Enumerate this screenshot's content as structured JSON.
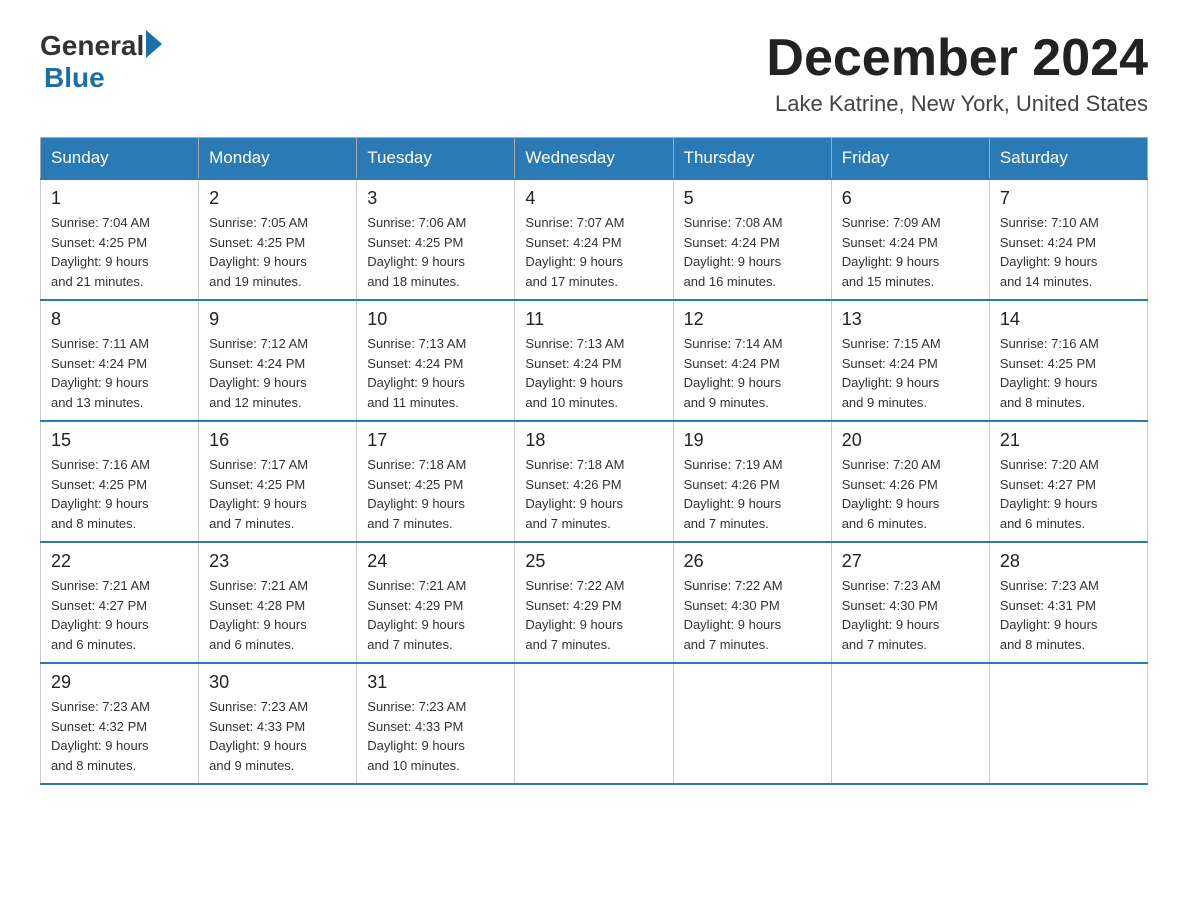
{
  "logo": {
    "general": "General",
    "blue": "Blue"
  },
  "title": "December 2024",
  "location": "Lake Katrine, New York, United States",
  "days_of_week": [
    "Sunday",
    "Monday",
    "Tuesday",
    "Wednesday",
    "Thursday",
    "Friday",
    "Saturday"
  ],
  "weeks": [
    [
      {
        "day": "1",
        "sunrise": "7:04 AM",
        "sunset": "4:25 PM",
        "daylight": "9 hours and 21 minutes."
      },
      {
        "day": "2",
        "sunrise": "7:05 AM",
        "sunset": "4:25 PM",
        "daylight": "9 hours and 19 minutes."
      },
      {
        "day": "3",
        "sunrise": "7:06 AM",
        "sunset": "4:25 PM",
        "daylight": "9 hours and 18 minutes."
      },
      {
        "day": "4",
        "sunrise": "7:07 AM",
        "sunset": "4:24 PM",
        "daylight": "9 hours and 17 minutes."
      },
      {
        "day": "5",
        "sunrise": "7:08 AM",
        "sunset": "4:24 PM",
        "daylight": "9 hours and 16 minutes."
      },
      {
        "day": "6",
        "sunrise": "7:09 AM",
        "sunset": "4:24 PM",
        "daylight": "9 hours and 15 minutes."
      },
      {
        "day": "7",
        "sunrise": "7:10 AM",
        "sunset": "4:24 PM",
        "daylight": "9 hours and 14 minutes."
      }
    ],
    [
      {
        "day": "8",
        "sunrise": "7:11 AM",
        "sunset": "4:24 PM",
        "daylight": "9 hours and 13 minutes."
      },
      {
        "day": "9",
        "sunrise": "7:12 AM",
        "sunset": "4:24 PM",
        "daylight": "9 hours and 12 minutes."
      },
      {
        "day": "10",
        "sunrise": "7:13 AM",
        "sunset": "4:24 PM",
        "daylight": "9 hours and 11 minutes."
      },
      {
        "day": "11",
        "sunrise": "7:13 AM",
        "sunset": "4:24 PM",
        "daylight": "9 hours and 10 minutes."
      },
      {
        "day": "12",
        "sunrise": "7:14 AM",
        "sunset": "4:24 PM",
        "daylight": "9 hours and 9 minutes."
      },
      {
        "day": "13",
        "sunrise": "7:15 AM",
        "sunset": "4:24 PM",
        "daylight": "9 hours and 9 minutes."
      },
      {
        "day": "14",
        "sunrise": "7:16 AM",
        "sunset": "4:25 PM",
        "daylight": "9 hours and 8 minutes."
      }
    ],
    [
      {
        "day": "15",
        "sunrise": "7:16 AM",
        "sunset": "4:25 PM",
        "daylight": "9 hours and 8 minutes."
      },
      {
        "day": "16",
        "sunrise": "7:17 AM",
        "sunset": "4:25 PM",
        "daylight": "9 hours and 7 minutes."
      },
      {
        "day": "17",
        "sunrise": "7:18 AM",
        "sunset": "4:25 PM",
        "daylight": "9 hours and 7 minutes."
      },
      {
        "day": "18",
        "sunrise": "7:18 AM",
        "sunset": "4:26 PM",
        "daylight": "9 hours and 7 minutes."
      },
      {
        "day": "19",
        "sunrise": "7:19 AM",
        "sunset": "4:26 PM",
        "daylight": "9 hours and 7 minutes."
      },
      {
        "day": "20",
        "sunrise": "7:20 AM",
        "sunset": "4:26 PM",
        "daylight": "9 hours and 6 minutes."
      },
      {
        "day": "21",
        "sunrise": "7:20 AM",
        "sunset": "4:27 PM",
        "daylight": "9 hours and 6 minutes."
      }
    ],
    [
      {
        "day": "22",
        "sunrise": "7:21 AM",
        "sunset": "4:27 PM",
        "daylight": "9 hours and 6 minutes."
      },
      {
        "day": "23",
        "sunrise": "7:21 AM",
        "sunset": "4:28 PM",
        "daylight": "9 hours and 6 minutes."
      },
      {
        "day": "24",
        "sunrise": "7:21 AM",
        "sunset": "4:29 PM",
        "daylight": "9 hours and 7 minutes."
      },
      {
        "day": "25",
        "sunrise": "7:22 AM",
        "sunset": "4:29 PM",
        "daylight": "9 hours and 7 minutes."
      },
      {
        "day": "26",
        "sunrise": "7:22 AM",
        "sunset": "4:30 PM",
        "daylight": "9 hours and 7 minutes."
      },
      {
        "day": "27",
        "sunrise": "7:23 AM",
        "sunset": "4:30 PM",
        "daylight": "9 hours and 7 minutes."
      },
      {
        "day": "28",
        "sunrise": "7:23 AM",
        "sunset": "4:31 PM",
        "daylight": "9 hours and 8 minutes."
      }
    ],
    [
      {
        "day": "29",
        "sunrise": "7:23 AM",
        "sunset": "4:32 PM",
        "daylight": "9 hours and 8 minutes."
      },
      {
        "day": "30",
        "sunrise": "7:23 AM",
        "sunset": "4:33 PM",
        "daylight": "9 hours and 9 minutes."
      },
      {
        "day": "31",
        "sunrise": "7:23 AM",
        "sunset": "4:33 PM",
        "daylight": "9 hours and 10 minutes."
      },
      null,
      null,
      null,
      null
    ]
  ],
  "labels": {
    "sunrise": "Sunrise:",
    "sunset": "Sunset:",
    "daylight": "Daylight:"
  }
}
